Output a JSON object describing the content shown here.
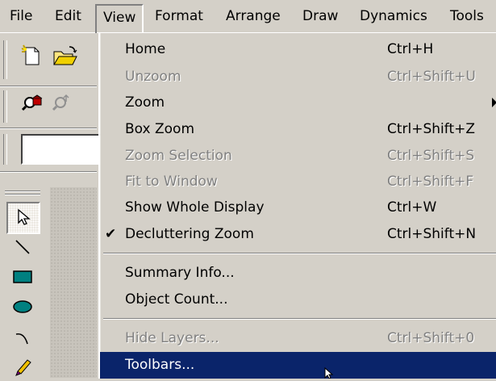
{
  "menubar": {
    "items": [
      "File",
      "Edit",
      "View",
      "Format",
      "Arrange",
      "Draw",
      "Dynamics",
      "Tools"
    ],
    "active": "View"
  },
  "toolbar": {
    "icons": [
      "new-document-icon",
      "open-folder-icon",
      "zoom-tool-icon",
      "pan-zoom-icon"
    ],
    "input_value": ""
  },
  "palette": {
    "tools": [
      "pointer-icon",
      "line-icon",
      "rectangle-icon",
      "ellipse-icon",
      "arc-icon",
      "pencil-icon"
    ],
    "selected": "pointer-icon",
    "shape_fill_color": "#008080"
  },
  "view_menu": {
    "items": [
      {
        "label": "Home",
        "shortcut": "Ctrl+H",
        "enabled": true
      },
      {
        "label": "Unzoom",
        "shortcut": "Ctrl+Shift+U",
        "enabled": false
      },
      {
        "label": "Zoom",
        "shortcut": "",
        "enabled": true,
        "submenu": true
      },
      {
        "label": "Box Zoom",
        "shortcut": "Ctrl+Shift+Z",
        "enabled": true
      },
      {
        "label": "Zoom Selection",
        "shortcut": "Ctrl+Shift+S",
        "enabled": false
      },
      {
        "label": "Fit to Window",
        "shortcut": "Ctrl+Shift+F",
        "enabled": false
      },
      {
        "label": "Show Whole Display",
        "shortcut": "Ctrl+W",
        "enabled": true
      },
      {
        "label": "Decluttering Zoom",
        "shortcut": "Ctrl+Shift+N",
        "enabled": true,
        "checked": true
      },
      {
        "label": "Summary Info...",
        "shortcut": "",
        "enabled": true
      },
      {
        "label": "Object Count...",
        "shortcut": "",
        "enabled": true
      },
      {
        "label": "Hide Layers...",
        "shortcut": "Ctrl+Shift+0",
        "enabled": false
      },
      {
        "label": "Toolbars...",
        "shortcut": "",
        "enabled": true,
        "highlighted": true
      }
    ],
    "highlight_color": "#0a246a"
  }
}
